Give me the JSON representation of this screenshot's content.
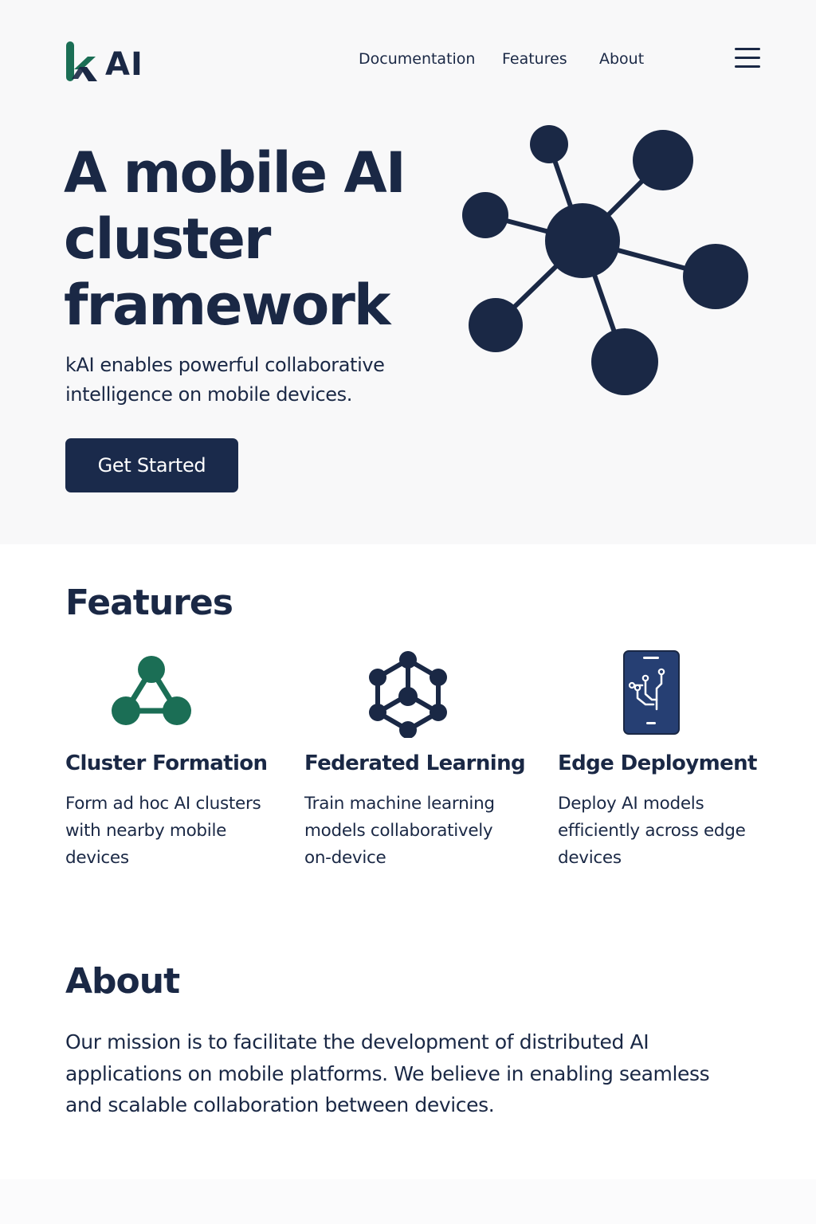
{
  "brand": {
    "name": "AI",
    "logo_icon": "k-letter-logo-icon"
  },
  "nav": {
    "items": [
      {
        "label": "Documentation"
      },
      {
        "label": "Features"
      },
      {
        "label": "About"
      }
    ],
    "menu_icon": "hamburger-menu-icon"
  },
  "hero": {
    "title": "A mobile AI cluster framework",
    "subtitle": "kAI enables powerful collaborative intelligence on mobile devices.",
    "cta_label": "Get Started",
    "graphic_icon": "network-nodes-icon"
  },
  "features": {
    "heading": "Features",
    "items": [
      {
        "icon": "triangle-cluster-icon",
        "title": "Cluster Formation",
        "description": "Form ad hoc AI clusters with nearby mobile devices"
      },
      {
        "icon": "hexagon-network-icon",
        "title": "Federated Learning",
        "description": "Train machine learning models collaboratively on-device"
      },
      {
        "icon": "mobile-circuit-icon",
        "title": "Edge Deployment",
        "description": "Deploy AI models efficiently across edge devices"
      }
    ]
  },
  "about": {
    "heading": "About",
    "text": "Our mission is to facilitate the development of distributed AI applications on mobile platforms. We believe in enabling seamless and scalable collaboration between devices."
  },
  "colors": {
    "navy": "#1a2845",
    "green": "#1b6e55",
    "button": "#1a2a4b",
    "phone": "#263f73"
  }
}
